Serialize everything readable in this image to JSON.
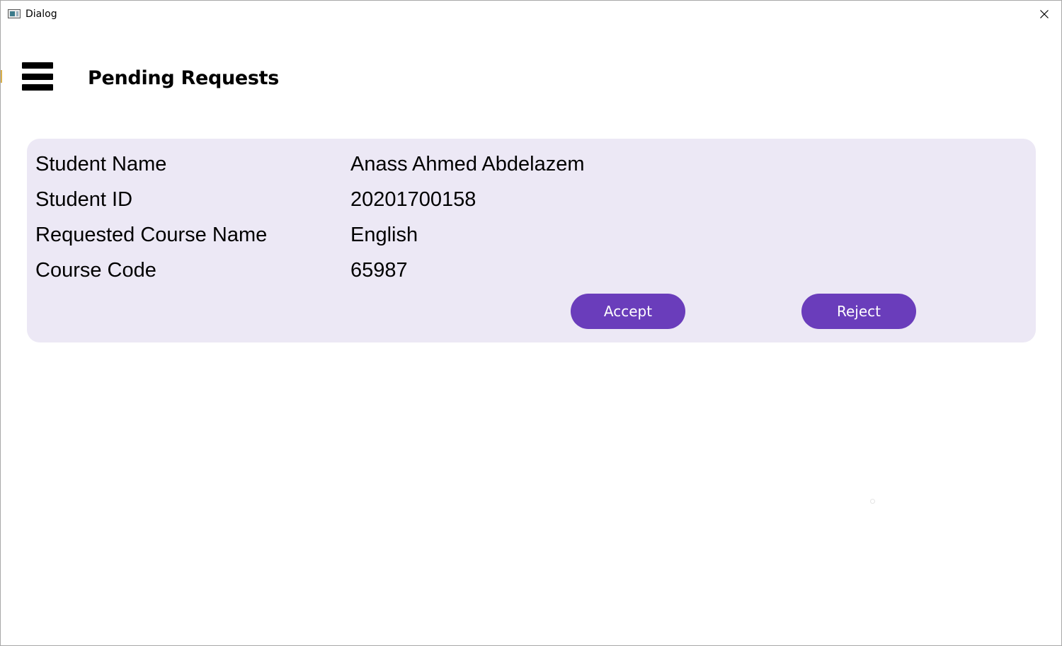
{
  "window": {
    "title": "Dialog"
  },
  "header": {
    "menu_icon": "hamburger-menu-icon",
    "title": "Pending Requests"
  },
  "request": {
    "fields": [
      {
        "label": "Student Name",
        "value": "Anass Ahmed Abdelazem"
      },
      {
        "label": "Student ID",
        "value": "20201700158"
      },
      {
        "label": "Requested Course Name",
        "value": "English"
      },
      {
        "label": "Course Code",
        "value": "65987"
      }
    ],
    "accept_label": "Accept",
    "reject_label": "Reject"
  },
  "colors": {
    "card_background": "#ece8f5",
    "button_background": "#6a3dbb",
    "button_text": "#ffffff"
  }
}
